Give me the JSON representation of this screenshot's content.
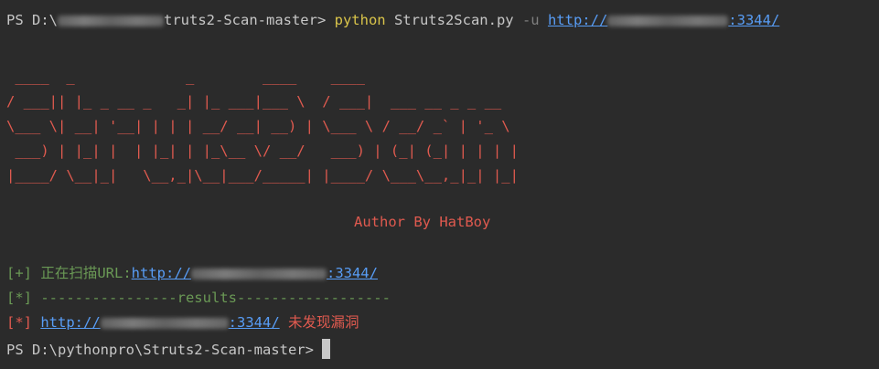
{
  "cmd": {
    "prompt": "PS D:\\",
    "prompt_tail": "truts2-Scan-master> ",
    "exe": "python",
    "script": " Struts2Scan.py ",
    "flag": "-u ",
    "url_head": "http://",
    "url_tail": ":3344/"
  },
  "banner": {
    "lines": [
      " ____  _             _        ____    ____                  ",
      "/ ___|| |_ _ __ _   _| |_ ___|___ \\  / ___|  ___ __ _ _ __  ",
      "\\___ \\| __| '__| | | | __/ __| __) | \\___ \\ / __/ _` | '_ \\ ",
      " ___) | |_| |  | |_| | |_\\__ \\/ __/   ___) | (_| (_| | | | |",
      "|____/ \\__|_|   \\__,_|\\__|___/_____| |____/ \\___\\__,_|_| |_|"
    ],
    "author": "Author By HatBoy"
  },
  "out": {
    "l1_tag": "[+] ",
    "l1_text": "正在扫描URL:",
    "l1_url_head": "http://",
    "l1_url_tail": ":3344/",
    "l2": "[*] ----------------results------------------",
    "l3_tag": "[*] ",
    "l3_url_head": "http://",
    "l3_url_tail": ":3344/",
    "l3_msg": " 未发现漏洞"
  },
  "prompt2": "PS D:\\pythonpro\\Struts2-Scan-master> ",
  "colors": {
    "background": "#2b2b2b",
    "text": "#c7c7c7",
    "command": "#d9c44a",
    "link": "#589df6",
    "banner": "#e05a4f",
    "green": "#6a9955"
  }
}
